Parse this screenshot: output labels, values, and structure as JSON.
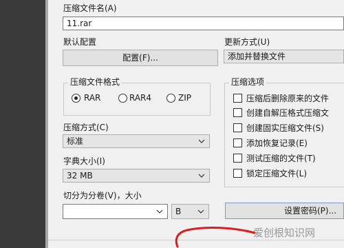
{
  "archive_name": {
    "label": "压缩文件名(A)",
    "value": "11.rar"
  },
  "profiles": {
    "label": "默认配置",
    "button": "配置(F)..."
  },
  "update_mode": {
    "label": "更新方式(U)",
    "value": "添加并替换文件"
  },
  "archive_format": {
    "title": "压缩文件格式",
    "options": [
      {
        "label": "RAR",
        "selected": true
      },
      {
        "label": "RAR4",
        "selected": false
      },
      {
        "label": "ZIP",
        "selected": false
      }
    ]
  },
  "compression_method": {
    "label": "压缩方式(C)",
    "value": "标准"
  },
  "dictionary_size": {
    "label": "字典大小(I)",
    "value": "32 MB"
  },
  "split_volumes": {
    "label": "切分为分卷(V)，大小",
    "value": "",
    "unit": "B"
  },
  "archive_options": {
    "title": "压缩选项",
    "items": [
      {
        "label": "压缩后删除原来的文件",
        "checked": false
      },
      {
        "label": "创建自解压格式压缩文",
        "checked": false
      },
      {
        "label": "创建固实压缩文件(S)",
        "checked": false
      },
      {
        "label": "添加恢复记录(E)",
        "checked": false
      },
      {
        "label": "测试压缩的文件(T)",
        "checked": false
      },
      {
        "label": "锁定压缩文件(L)",
        "checked": false
      }
    ]
  },
  "set_password": {
    "label": "设置密码(P)..."
  },
  "watermark": {
    "text": "爱创根知识网"
  },
  "annotation": {
    "color": "#d81e1e"
  }
}
